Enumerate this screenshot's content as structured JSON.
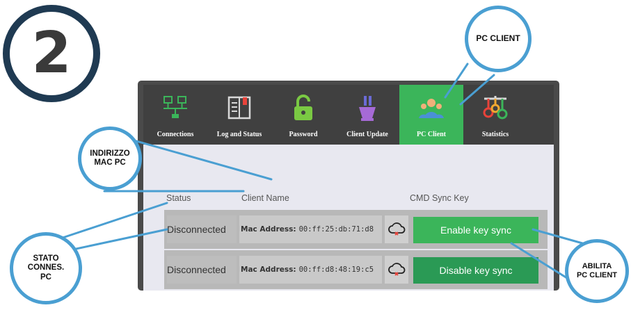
{
  "step_number": "2",
  "callouts": {
    "pc_client": "PC CLIENT",
    "indirizzo_mac": "INDIRIZZO\nMAC PC",
    "stato_connes": "STATO\nCONNES.\nPC",
    "abilita_pc_client": "ABILITA\nPC CLIENT"
  },
  "nav": {
    "tabs": [
      {
        "label": "Connections",
        "icon": "network-icon",
        "active": false
      },
      {
        "label": "Log and Status",
        "icon": "log-book-icon",
        "active": false
      },
      {
        "label": "Password",
        "icon": "unlocked-padlock-icon",
        "active": false
      },
      {
        "label": "Client Update",
        "icon": "update-flask-icon",
        "active": false
      },
      {
        "label": "PC Client",
        "icon": "users-icon",
        "active": true
      },
      {
        "label": "Statistics",
        "icon": "statistics-icon",
        "active": false
      }
    ]
  },
  "table": {
    "headers": {
      "status": "Status",
      "client_name": "Client Name",
      "cmd_sync_key": "CMD Sync Key"
    },
    "rows": [
      {
        "status": "Disconnected",
        "mac_label": "Mac Address:",
        "mac_value": "00:ff:25:db:71:d8",
        "cloud_icon": "cloud-disconnected-icon",
        "button_label": "Enable key sync",
        "button_color": "#3bb55a"
      },
      {
        "status": "Disconnected",
        "mac_label": "Mac Address:",
        "mac_value": "00:ff:d8:48:19:c5",
        "cloud_icon": "cloud-disconnected-icon",
        "button_label": "Disable key sync",
        "button_color": "#2a9a55"
      }
    ]
  },
  "colors": {
    "accent_green": "#3bb55a",
    "callout_border": "#4a9fd2",
    "step_ring": "#1f3a52",
    "topbar": "#404040"
  }
}
